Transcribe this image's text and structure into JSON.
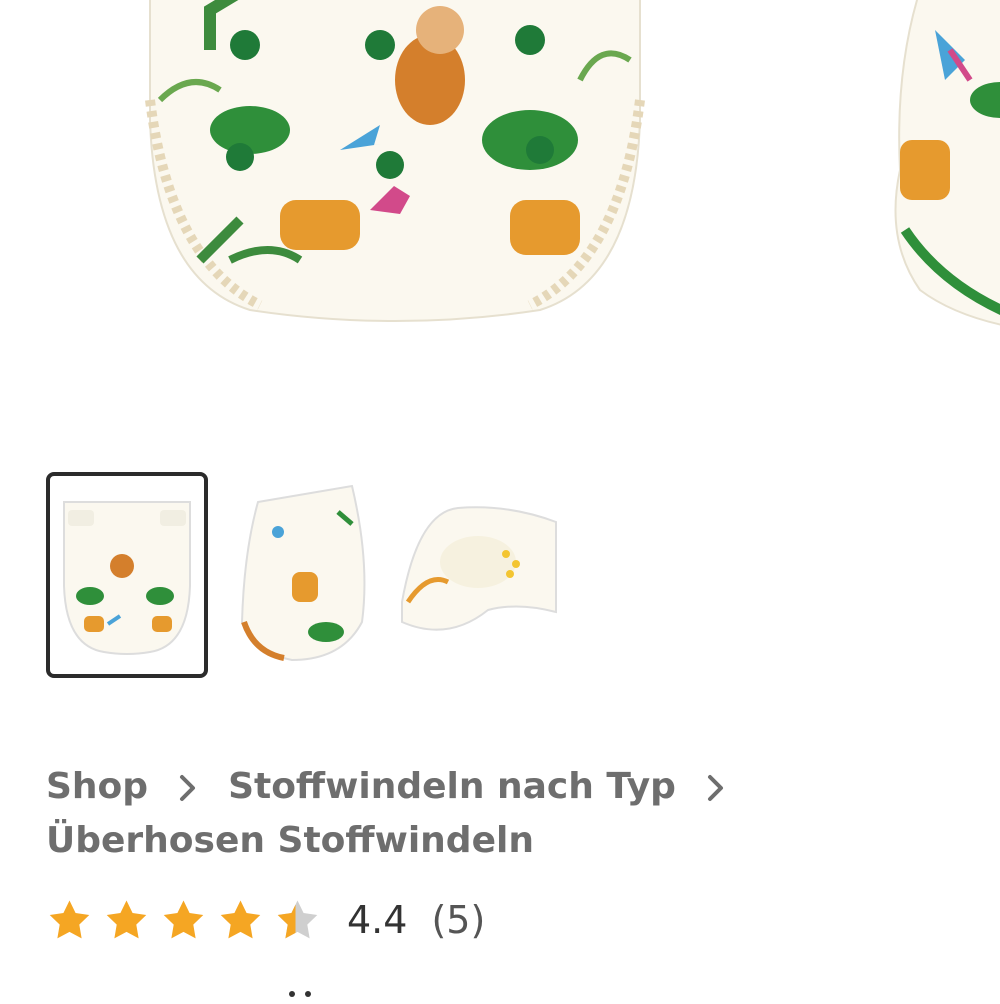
{
  "gallery": {
    "main_image_alt": "Überhose Stoffwindel mit Dschungel-Print",
    "thumbnails": [
      {
        "label": "Ansicht vorne",
        "selected": true
      },
      {
        "label": "Ansicht seitlich",
        "selected": false
      },
      {
        "label": "Ansicht innen",
        "selected": false
      }
    ]
  },
  "breadcrumb": {
    "items": [
      "Shop",
      "Stoffwindeln nach Typ",
      "Überhosen Stoffwindeln"
    ],
    "separator": ">"
  },
  "rating": {
    "value": "4.4",
    "count": "(5)",
    "stars": 4.4,
    "star_color": "#f5a623",
    "star_empty_color": "#cfcfcf"
  },
  "colors": {
    "text_gray": "#6e6e6e",
    "selected_border": "#2b2b2b"
  }
}
